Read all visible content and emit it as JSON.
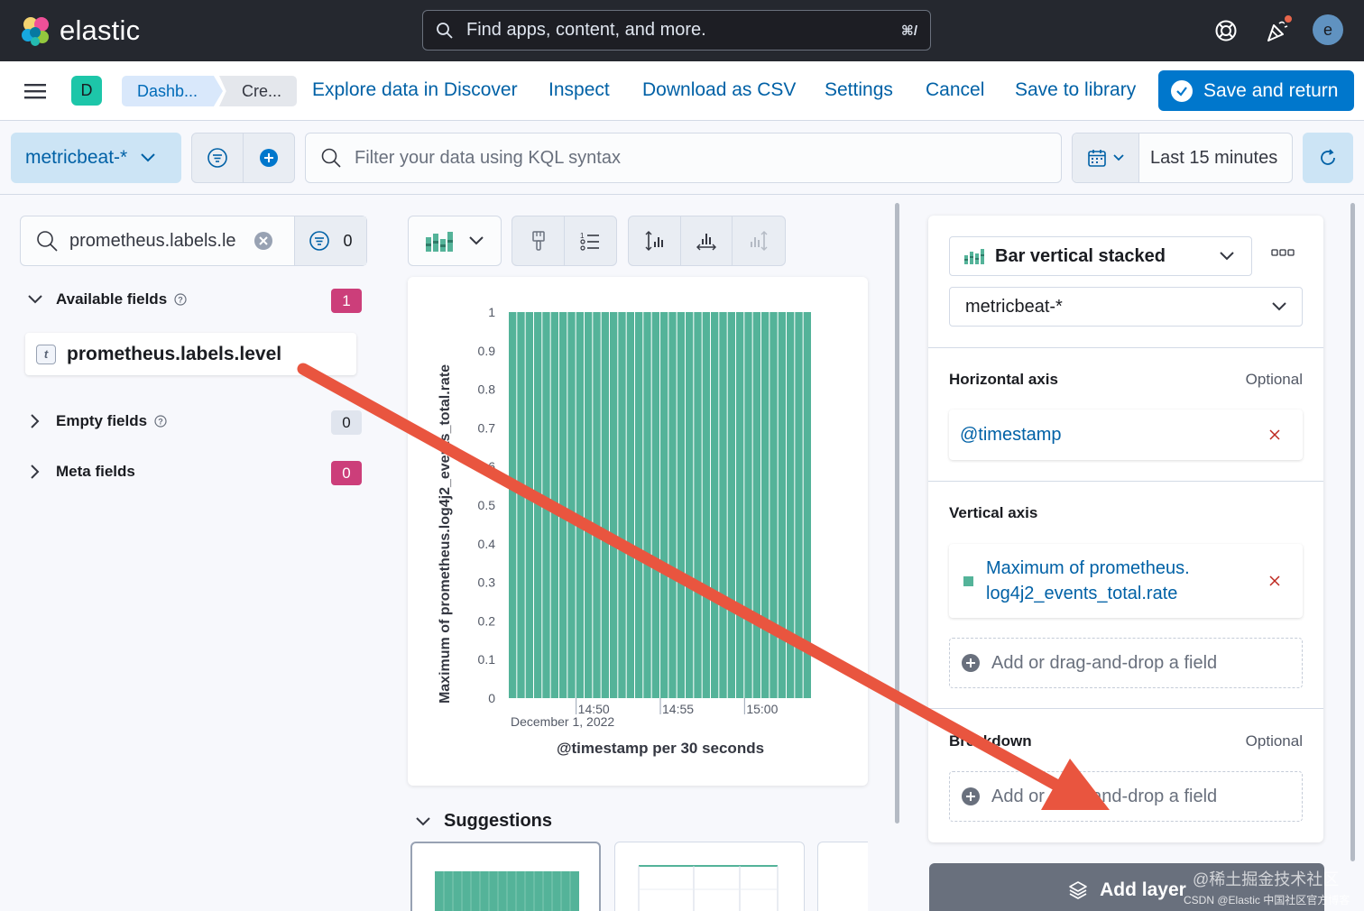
{
  "topbar": {
    "logo_text": "elastic",
    "search_placeholder": "Find apps, content, and more.",
    "search_shortcut": "⌘/",
    "avatar_initial": "e"
  },
  "appbar": {
    "space_initial": "D",
    "breadcrumbs": [
      "Dashb...",
      "Cre..."
    ],
    "links": {
      "explore": "Explore data in Discover",
      "inspect": "Inspect",
      "download": "Download as CSV",
      "settings": "Settings",
      "cancel": "Cancel",
      "save_library": "Save to library"
    },
    "save_return": "Save and return"
  },
  "querybar": {
    "data_view": "metricbeat-*",
    "kql_placeholder": "Filter your data using KQL syntax",
    "time_range": "Last 15 minutes"
  },
  "fields": {
    "search_value": "prometheus.labels.le",
    "filter_count": "0",
    "available": {
      "label": "Available fields",
      "count": "1"
    },
    "field_item": "prometheus.labels.level",
    "field_type": "t",
    "empty": {
      "label": "Empty fields",
      "count": "0"
    },
    "meta": {
      "label": "Meta fields",
      "count": "0"
    }
  },
  "chart_data": {
    "type": "bar",
    "stacked": true,
    "ylabel": "Maximum of prometheus.log4j2_events_total.rate",
    "xlabel": "@timestamp per 30 seconds",
    "y_ticks": [
      "0",
      "0.1",
      "0.2",
      "0.3",
      "0.4",
      "0.5",
      "0.6",
      "0.7",
      "0.8",
      "0.9",
      "1"
    ],
    "ylim": [
      0,
      1
    ],
    "x_ticks": [
      "14:50",
      "14:55",
      "15:00"
    ],
    "x_subtitle": "December 1, 2022",
    "x_range": [
      "14:46",
      "15:04"
    ],
    "bar_count": 36,
    "bar_values": [
      1,
      1,
      1,
      1,
      1,
      1,
      1,
      1,
      1,
      1,
      1,
      1,
      1,
      1,
      1,
      1,
      1,
      1,
      1,
      1,
      1,
      1,
      1,
      1,
      1,
      1,
      1,
      1,
      1,
      1,
      1,
      1,
      1,
      1,
      1,
      1
    ],
    "bar_color": "#54b399",
    "grid": false
  },
  "suggestions": {
    "title": "Suggestions"
  },
  "config": {
    "chart_type": "Bar vertical stacked",
    "data_view": "metricbeat-*",
    "horizontal_axis": {
      "title": "Horizontal axis",
      "optional": "Optional",
      "field": "@timestamp"
    },
    "vertical_axis": {
      "title": "Vertical axis",
      "field_line1": "Maximum of prometheus.",
      "field_line2": "log4j2_events_total.rate",
      "add": "Add or drag-and-drop a field"
    },
    "breakdown": {
      "title": "Breakdown",
      "optional": "Optional",
      "add": "Add or drag-and-drop a field"
    },
    "add_layer": "Add layer"
  },
  "watermark": {
    "line1": "@稀土掘金技术社区",
    "line2": "CSDN @Elastic 中国社区官方博客"
  },
  "colors": {
    "accent": "#0077cc",
    "header": "#25282f",
    "bar": "#54b399",
    "annotation_arrow": "#e9553f"
  }
}
